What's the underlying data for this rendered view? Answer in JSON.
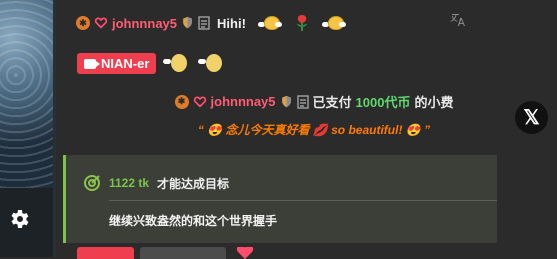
{
  "chat": {
    "message1": {
      "username": "johnnnay5",
      "text": "Hihi!"
    },
    "message2": {
      "badge": "NIAN-er"
    },
    "tip": {
      "username": "johnnnay5",
      "pre": "已支付",
      "amount": "1000代币",
      "post": "的小费",
      "quote": "“ 😍 念儿今天真好看 💋 so beautiful! 😍 ”"
    },
    "goal": {
      "amount": "1122 tk",
      "label": "才能达成目标",
      "description": "继续兴致盎然的和这个世界握手"
    }
  },
  "icons": {
    "translate": "translate-icon",
    "close": "x-logo-icon",
    "settings": "gear-icon",
    "goal": "target-icon"
  },
  "colors": {
    "accent_red": "#ef3f4f",
    "username_red": "#ff5d73",
    "goal_green": "#7bc34a",
    "tip_orange": "#ff7b00"
  }
}
